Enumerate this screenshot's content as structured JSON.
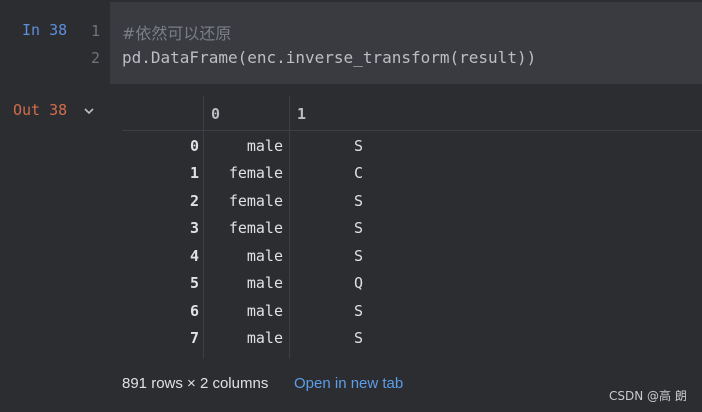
{
  "input_cell": {
    "prompt": "In 38",
    "line_numbers": [
      "1",
      "2"
    ],
    "lines": [
      "#依然可以还原",
      "pd.DataFrame(enc.inverse_transform(result))"
    ]
  },
  "output_cell": {
    "prompt": "Out 38",
    "collapse_icon": "chevron-down-icon",
    "columns": [
      "0",
      "1"
    ],
    "rows": [
      {
        "index": "0",
        "c0": "male",
        "c1": "S"
      },
      {
        "index": "1",
        "c0": "female",
        "c1": "C"
      },
      {
        "index": "2",
        "c0": "female",
        "c1": "S"
      },
      {
        "index": "3",
        "c0": "female",
        "c1": "S"
      },
      {
        "index": "4",
        "c0": "male",
        "c1": "S"
      },
      {
        "index": "5",
        "c0": "male",
        "c1": "Q"
      },
      {
        "index": "6",
        "c0": "male",
        "c1": "S"
      },
      {
        "index": "7",
        "c0": "male",
        "c1": "S"
      }
    ],
    "summary": "891 rows × 2 columns",
    "open_link": "Open in new tab"
  },
  "watermark": "CSDN @高 朗",
  "colors": {
    "background": "#2b2d30",
    "code_background": "#393b40",
    "in_prompt": "#5c8fdc",
    "out_prompt": "#d16d4d",
    "link": "#5c9ee8"
  }
}
